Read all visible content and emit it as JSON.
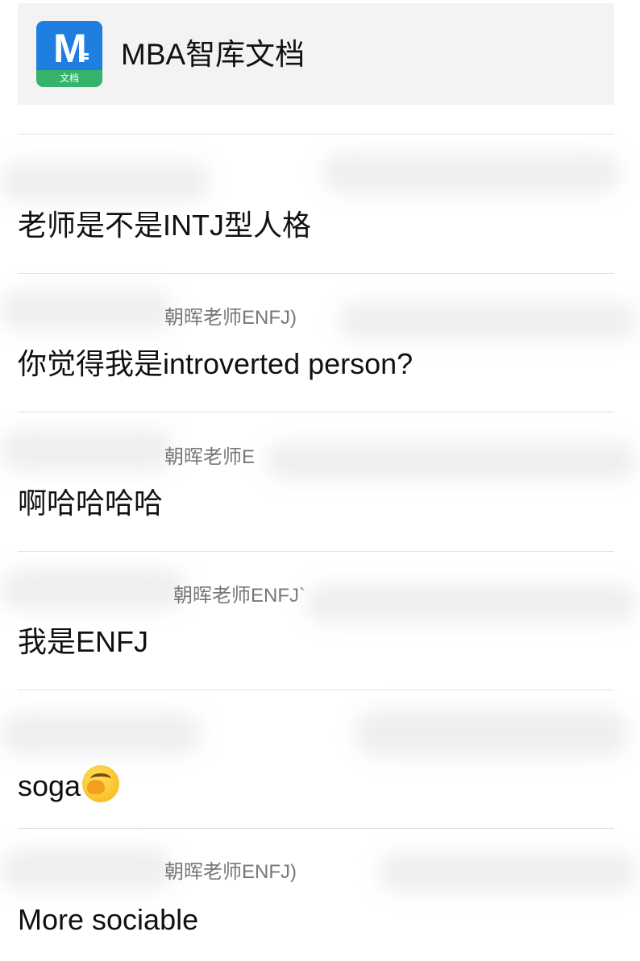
{
  "header": {
    "logo_letter": "M",
    "logo_caption": "文档",
    "title": "MBA智库文档"
  },
  "messages": [
    {
      "meta": "",
      "text": "老师是不是INTJ型人格"
    },
    {
      "meta": "朝晖老师ENFJ)",
      "text": "你觉得我是introverted person?"
    },
    {
      "meta": "朝晖老师E",
      "text": "啊哈哈哈哈"
    },
    {
      "meta": "朝晖老师ENFJ`",
      "text": "我是ENFJ"
    },
    {
      "meta": "",
      "text": "soga",
      "emoji": "face-palm-laughing-emoji"
    },
    {
      "meta": "朝晖老师ENFJ)",
      "text": "More sociable"
    }
  ],
  "colors": {
    "logo_blue": "#1e7fe0",
    "logo_green": "#36b36a",
    "header_bg": "#f3f3f3",
    "meta_gray": "#777777"
  }
}
